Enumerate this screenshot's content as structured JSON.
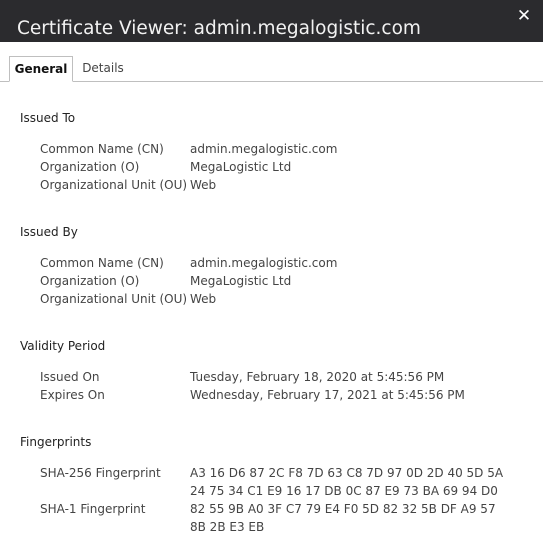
{
  "window": {
    "title": "Certificate Viewer: admin.megalogistic.com",
    "close_glyph": "✕"
  },
  "tabs": [
    {
      "label": "General",
      "active": true
    },
    {
      "label": "Details",
      "active": false
    }
  ],
  "issued_to": {
    "title": "Issued To",
    "cn_label": "Common Name (CN)",
    "cn_value": "admin.megalogistic.com",
    "org_label": "Organization (O)",
    "org_value": "MegaLogistic Ltd",
    "ou_label": "Organizational Unit (OU)",
    "ou_value": "Web"
  },
  "issued_by": {
    "title": "Issued By",
    "cn_label": "Common Name (CN)",
    "cn_value": "admin.megalogistic.com",
    "org_label": "Organization (O)",
    "org_value": "MegaLogistic Ltd",
    "ou_label": "Organizational Unit (OU)",
    "ou_value": "Web"
  },
  "validity": {
    "title": "Validity Period",
    "issued_label": "Issued On",
    "issued_value": "Tuesday, February 18, 2020 at 5:45:56 PM",
    "expires_label": "Expires On",
    "expires_value": "Wednesday, February 17, 2021 at 5:45:56 PM"
  },
  "fingerprints": {
    "title": "Fingerprints",
    "sha256_label": "SHA-256 Fingerprint",
    "sha256_line1": "A3 16 D6 87 2C F8 7D 63 C8 7D 97 0D 2D 40 5D 5A",
    "sha256_line2": "24 75 34 C1 E9 16 17 DB 0C 87 E9 73 BA 69 94 D0",
    "sha1_label": "SHA-1 Fingerprint",
    "sha1_line1": "82 55 9B A0 3F C7 79 E4 F0 5D 82 32 5B DF A9 57",
    "sha1_line2": "8B 2B E3 EB"
  }
}
